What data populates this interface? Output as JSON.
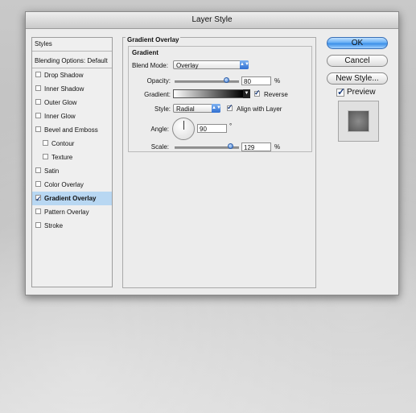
{
  "window": {
    "title": "Layer Style"
  },
  "styles_panel": {
    "header": "Styles",
    "blending_options": "Blending Options: Default",
    "items": [
      {
        "label": "Drop Shadow",
        "checked": false,
        "sub": false,
        "active": false
      },
      {
        "label": "Inner Shadow",
        "checked": false,
        "sub": false,
        "active": false
      },
      {
        "label": "Outer Glow",
        "checked": false,
        "sub": false,
        "active": false
      },
      {
        "label": "Inner Glow",
        "checked": false,
        "sub": false,
        "active": false
      },
      {
        "label": "Bevel and Emboss",
        "checked": false,
        "sub": false,
        "active": false
      },
      {
        "label": "Contour",
        "checked": false,
        "sub": true,
        "active": false
      },
      {
        "label": "Texture",
        "checked": false,
        "sub": true,
        "active": false
      },
      {
        "label": "Satin",
        "checked": false,
        "sub": false,
        "active": false
      },
      {
        "label": "Color Overlay",
        "checked": false,
        "sub": false,
        "active": false
      },
      {
        "label": "Gradient Overlay",
        "checked": true,
        "sub": false,
        "active": true
      },
      {
        "label": "Pattern Overlay",
        "checked": false,
        "sub": false,
        "active": false
      },
      {
        "label": "Stroke",
        "checked": false,
        "sub": false,
        "active": false
      }
    ]
  },
  "gradient_overlay": {
    "section_title": "Gradient Overlay",
    "group_title": "Gradient",
    "blend_mode_label": "Blend Mode:",
    "blend_mode_value": "Overlay",
    "opacity_label": "Opacity:",
    "opacity_value": "80",
    "opacity_fraction": 0.8,
    "percent_symbol": "%",
    "gradient_label": "Gradient:",
    "reverse_label": "Reverse",
    "reverse_checked": true,
    "style_label": "Style:",
    "style_value": "Radial",
    "align_label": "Align with Layer",
    "align_checked": true,
    "angle_label": "Angle:",
    "angle_value": "90",
    "degree_symbol": "°",
    "scale_label": "Scale:",
    "scale_value": "129",
    "scale_fraction": 0.86
  },
  "buttons": {
    "ok": "OK",
    "cancel": "Cancel",
    "new_style": "New Style..."
  },
  "preview": {
    "label": "Preview",
    "checked": true
  },
  "colors": {
    "accent": "#3b8fe8",
    "active_row": "#b8d7f2"
  },
  "icons": {
    "arrow": "dropdown-arrow-icon",
    "check": "checkmark-icon"
  }
}
